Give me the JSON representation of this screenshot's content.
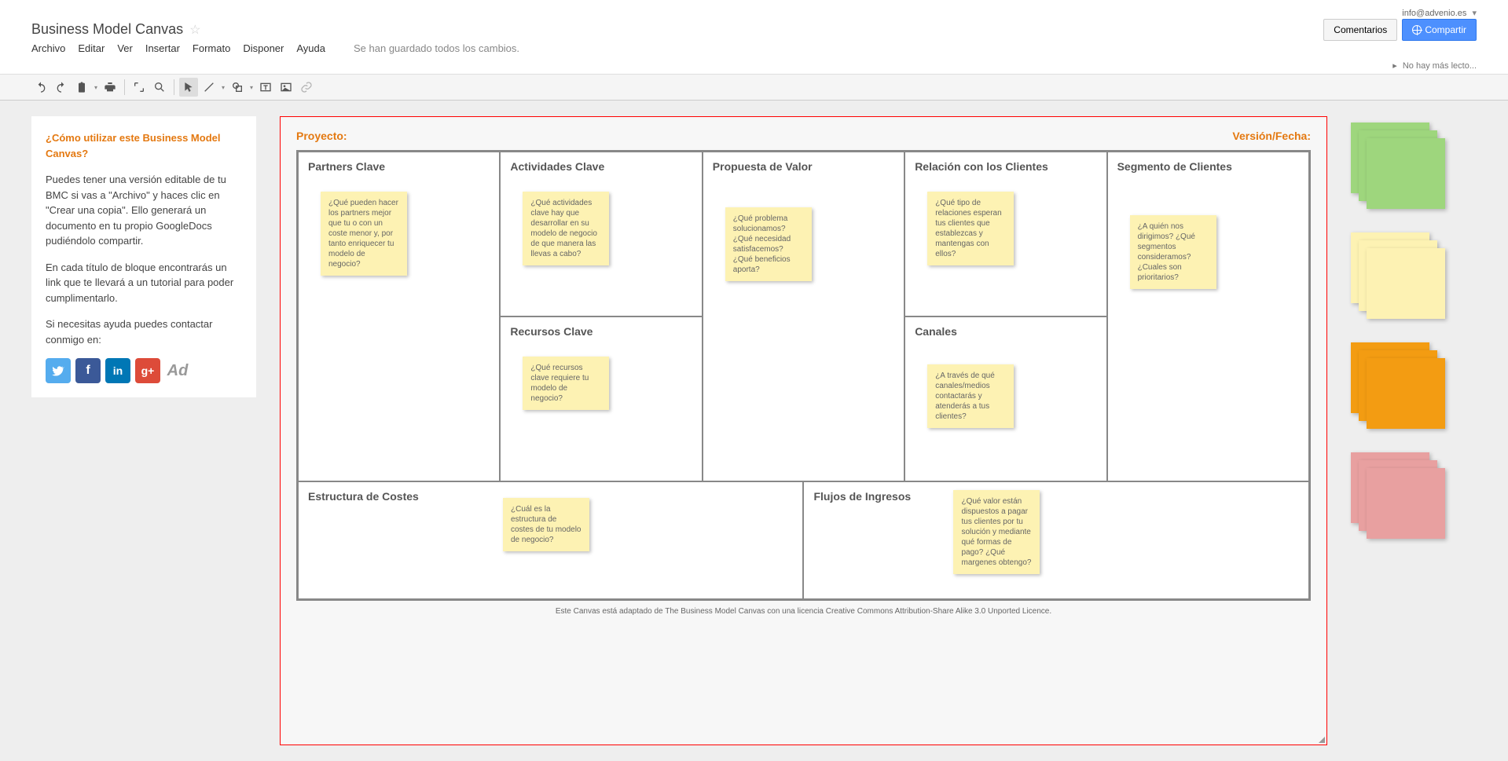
{
  "account_email": "info@advenio.es",
  "doc_title": "Business Model Canvas",
  "menus": [
    "Archivo",
    "Editar",
    "Ver",
    "Insertar",
    "Formato",
    "Disponer",
    "Ayuda"
  ],
  "save_status": "Se han guardado todos los cambios.",
  "readers_status": "No hay más lecto...",
  "btn_comments": "Comentarios",
  "btn_share": "Compartir",
  "sidebar": {
    "title": "¿Cómo utilizar este Business Model Canvas?",
    "p1": "Puedes tener una versión editable de tu BMC si vas a \"Archivo\" y haces clic en \"Crear una copia\". Ello generará un documento en tu propio GoogleDocs pudiéndolo compartir.",
    "p2": "En cada título de bloque encontrarás un link que te llevará a un tutorial para poder cumplimentarlo.",
    "p3": "Si necesitas ayuda puedes contactar conmigo en:"
  },
  "canvas": {
    "label_project": "Proyecto:",
    "label_version": "Versión/Fecha:",
    "partners": {
      "title": "Partners Clave",
      "note": "¿Qué pueden hacer los partners mejor que tu o con un coste menor y, por tanto enriquecer tu modelo de negocio?"
    },
    "activities": {
      "title": "Actividades Clave",
      "note": "¿Qué actividades clave hay que desarrollar en su modelo de negocio de que manera las llevas a cabo?"
    },
    "value": {
      "title": "Propuesta de Valor",
      "note": "¿Qué problema solucionamos? ¿Qué necesidad satisfacemos? ¿Qué beneficios aporta?"
    },
    "relation": {
      "title": "Relación con los Clientes",
      "note": "¿Qué tipo de relaciones esperan tus clientes que establezcas y mantengas con ellos?"
    },
    "segment": {
      "title": "Segmento de Clientes",
      "note": "¿A quién nos dirigimos? ¿Qué segmentos consideramos? ¿Cuales son prioritarios?"
    },
    "resources": {
      "title": "Recursos Clave",
      "note": "¿Qué recursos clave requiere tu modelo de negocio?"
    },
    "channels": {
      "title": "Canales",
      "note": "¿A través de qué canales/medios contactarás y atenderás a tus clientes?"
    },
    "costs": {
      "title": "Estructura de Costes",
      "note": "¿Cuál es la estructura de costes de tu modelo de negocio?"
    },
    "revenue": {
      "title": "Flujos de Ingresos",
      "note": "¿Qué valor están dispuestos a pagar tus clientes por tu solución y mediante qué formas de pago? ¿Qué margenes obtengo?"
    },
    "footer": "Este Canvas está adaptado de The Business Model Canvas con una licencia Creative Commons Attribution-Share Alike 3.0 Unported Licence."
  },
  "social": {
    "ad": "Ad"
  }
}
